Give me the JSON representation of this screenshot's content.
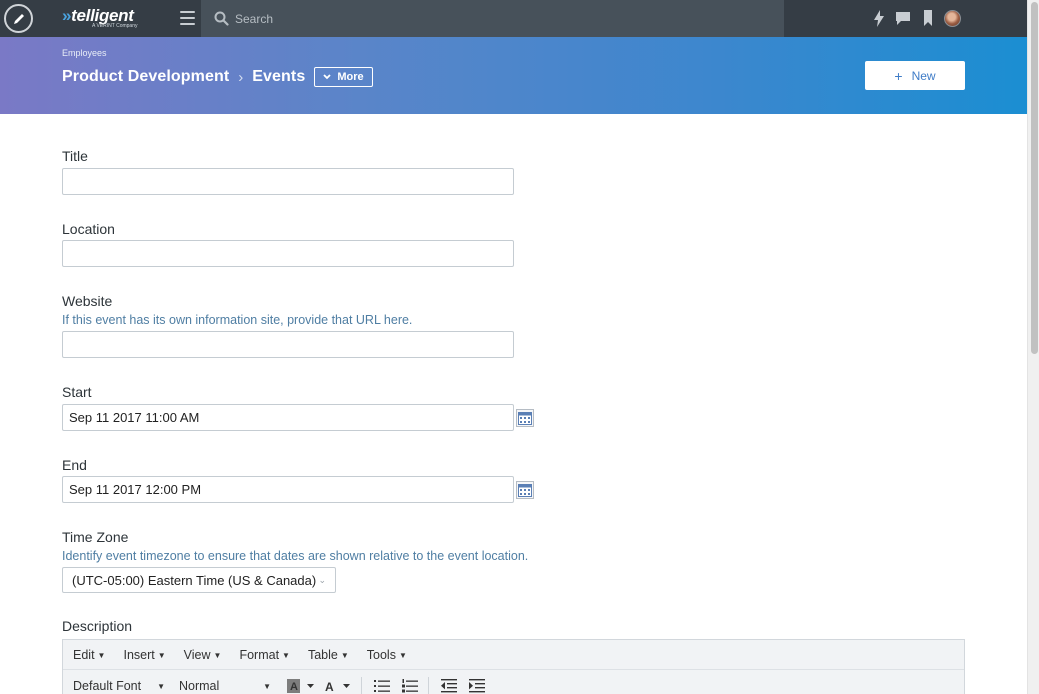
{
  "nav": {
    "logo_text": "telligent",
    "logo_sub": "A VERINT Company",
    "search_placeholder": "Search",
    "icons": [
      "edit-icon",
      "menu-icon",
      "search-icon",
      "activity-icon",
      "chat-icon",
      "bookmark-icon",
      "user-avatar"
    ]
  },
  "header": {
    "breadcrumb_top": "Employees",
    "group": "Product Development",
    "separator": "›",
    "page": "Events",
    "more_label": "More",
    "new_label": "New"
  },
  "form": {
    "title_label": "Title",
    "title_value": "",
    "location_label": "Location",
    "location_value": "",
    "website_label": "Website",
    "website_help": "If this event has its own information site, provide that URL here.",
    "website_value": "",
    "start_label": "Start",
    "start_value": "Sep 11 2017 11:00 AM",
    "end_label": "End",
    "end_value": "Sep 11 2017 12:00 PM",
    "timezone_label": "Time Zone",
    "timezone_help": "Identify event timezone to ensure that dates are shown relative to the event location.",
    "timezone_value": "(UTC-05:00) Eastern Time (US & Canada)",
    "description_label": "Description"
  },
  "editor": {
    "menus": [
      "Edit",
      "Insert",
      "View",
      "Format",
      "Table",
      "Tools"
    ],
    "font_value": "Default Font",
    "size_value": "Normal"
  },
  "colors": {
    "nav_bg": "#353d45",
    "header_start": "#7a79c6",
    "header_end": "#1b8ed2",
    "help_text": "#4f7ea3"
  }
}
